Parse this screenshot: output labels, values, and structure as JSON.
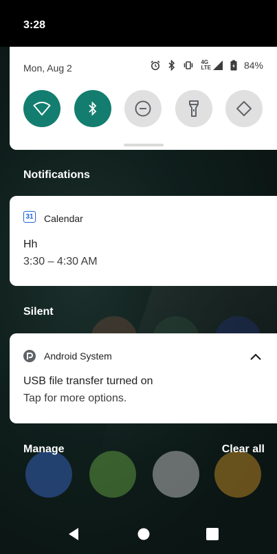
{
  "status_bar": {
    "time": "3:28"
  },
  "quick_settings": {
    "date": "Mon, Aug 2",
    "network_label_top": "4G",
    "network_label_bottom": "LTE",
    "battery": "84%",
    "tiles": [
      {
        "name": "wifi",
        "state": "on"
      },
      {
        "name": "bluetooth",
        "state": "on"
      },
      {
        "name": "do-not-disturb",
        "state": "off"
      },
      {
        "name": "flashlight",
        "state": "off"
      },
      {
        "name": "auto-rotate",
        "state": "off"
      }
    ]
  },
  "notifications_header": "Notifications",
  "calendar_notification": {
    "app_icon_label": "31",
    "app": "Calendar",
    "title": "Hh",
    "time": "3:30 – 4:30 AM"
  },
  "silent_header": "Silent",
  "system_notification": {
    "app": "Android System",
    "title": "USB file transfer turned on",
    "text": "Tap for more options."
  },
  "footer": {
    "manage": "Manage",
    "clear_all": "Clear all"
  },
  "colors": {
    "accent": "#137e6f",
    "calendar_blue": "#1e63d6"
  }
}
